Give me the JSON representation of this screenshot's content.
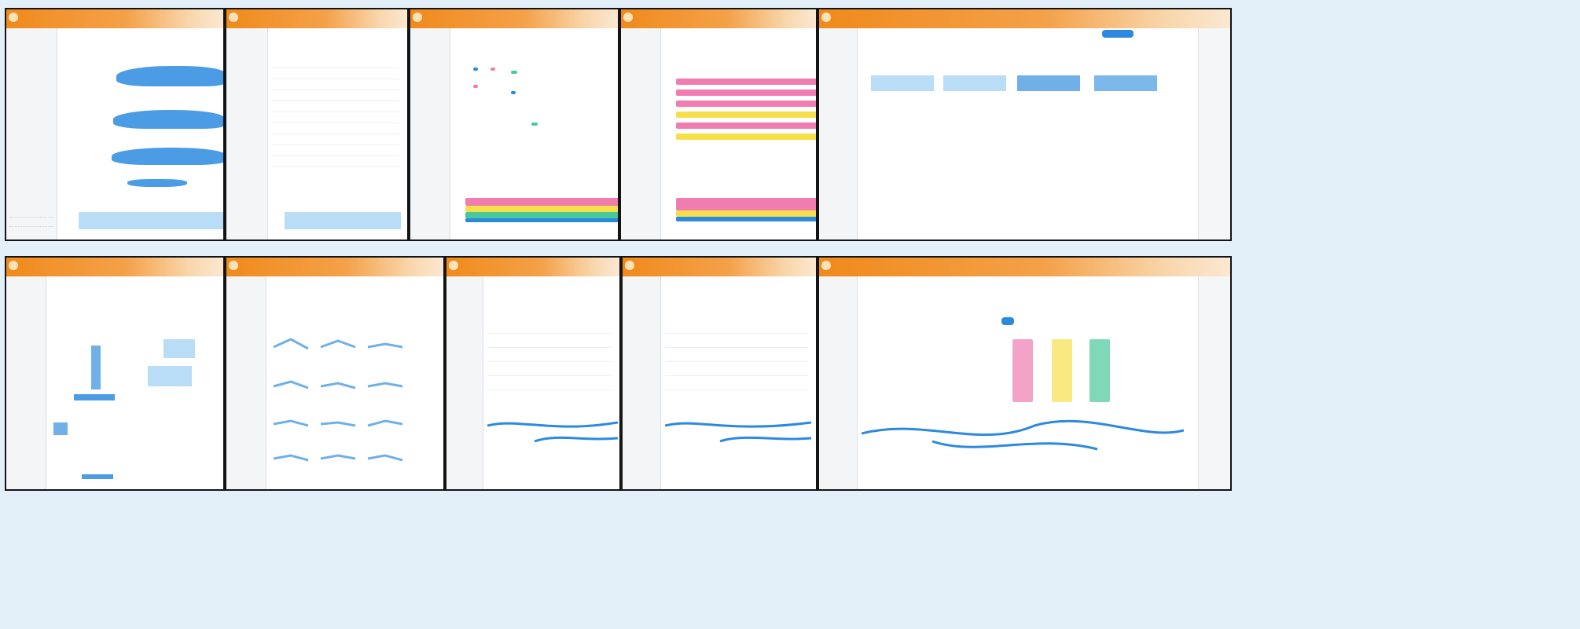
{
  "app": {
    "brand": "",
    "menu": [
      "",
      "",
      "",
      "",
      "",
      "",
      "",
      ""
    ],
    "sidebar_items": [
      "",
      "",
      "",
      "",
      ""
    ]
  },
  "panels": [
    {
      "id": "profile-overview",
      "kind": "distribution-rows"
    },
    {
      "id": "data-table",
      "kind": "table"
    },
    {
      "id": "heatmap-table",
      "kind": "table-heatmap"
    },
    {
      "id": "heatmap-bands",
      "kind": "heatmap"
    },
    {
      "id": "summary-histograms",
      "kind": "histograms"
    },
    {
      "id": "scatter-network",
      "kind": "scatter"
    },
    {
      "id": "small-multiples",
      "kind": "small-multiples"
    },
    {
      "id": "table-flow-a",
      "kind": "table-flow"
    },
    {
      "id": "table-flow-b",
      "kind": "table-flow"
    },
    {
      "id": "table-flow-c",
      "kind": "table-flow"
    }
  ],
  "colors": {
    "background": "#e3f0f9",
    "topbar": "#f08a1c",
    "accent_blue": "#2b8ae0",
    "light_blue": "#b9dcf7",
    "pink": "#f07cb0",
    "yellow": "#f6e04a",
    "green": "#49c89a",
    "frame": "#141414"
  },
  "icons": [
    "app-logo-icon",
    "window-frame"
  ]
}
